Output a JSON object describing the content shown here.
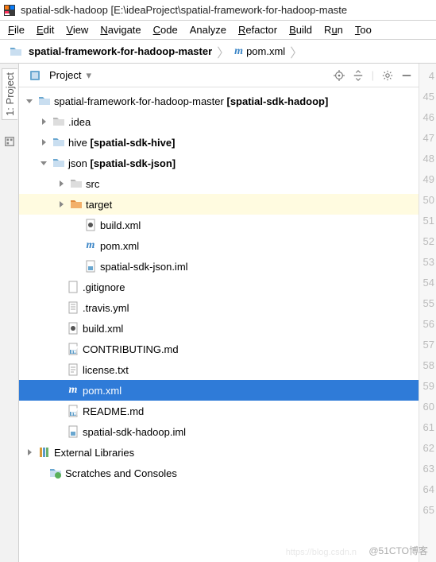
{
  "titlebar": {
    "text": "spatial-sdk-hadoop [E:\\ideaProject\\spatial-framework-for-hadoop-maste"
  },
  "menu": {
    "file": "File",
    "edit": "Edit",
    "view": "View",
    "navigate": "Navigate",
    "code": "Code",
    "analyze": "Analyze",
    "refactor": "Refactor",
    "build": "Build",
    "run": "Run",
    "too": "Too"
  },
  "breadcrumb": {
    "item1": "spatial-framework-for-hadoop-master",
    "item2": "pom.xml"
  },
  "panel": {
    "title": "Project"
  },
  "sidebar": {
    "project_label": "1: Project"
  },
  "tree": {
    "root": {
      "name": "spatial-framework-for-hadoop-master",
      "module": "[spatial-sdk-hadoop]"
    },
    "idea": ".idea",
    "hive": {
      "name": "hive",
      "module": "[spatial-sdk-hive]"
    },
    "json": {
      "name": "json",
      "module": "[spatial-sdk-json]"
    },
    "src": "src",
    "target": "target",
    "json_buildxml": "build.xml",
    "json_pomxml": "pom.xml",
    "json_iml": "spatial-sdk-json.iml",
    "gitignore": ".gitignore",
    "travis": ".travis.yml",
    "buildxml": "build.xml",
    "contributing": "CONTRIBUTING.md",
    "license": "license.txt",
    "pomxml": "pom.xml",
    "readme": "README.md",
    "root_iml": "spatial-sdk-hadoop.iml",
    "ext_lib": "External Libraries",
    "scratches": "Scratches and Consoles"
  },
  "gutter": [
    "4",
    "45",
    "46",
    "47",
    "48",
    "49",
    "50",
    "51",
    "52",
    "53",
    "54",
    "55",
    "56",
    "57",
    "58",
    "59",
    "60",
    "61",
    "62",
    "63",
    "64",
    "65"
  ],
  "watermark": "@51CTO博客",
  "watermark_url": "https://blog.csdn.n"
}
